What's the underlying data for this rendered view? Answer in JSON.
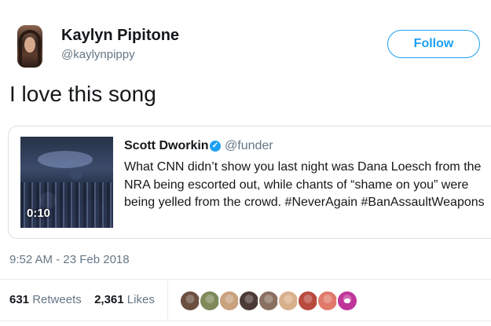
{
  "author": {
    "display_name": "Kaylyn Pipitone",
    "handle": "@kaylynpippy",
    "avatar_icon": "profile-photo"
  },
  "follow_button": {
    "label": "Follow",
    "color": "#1da1f2"
  },
  "tweet": {
    "text": "I love this song"
  },
  "quoted_tweet": {
    "author_name": "Scott Dworkin",
    "verified_icon": "verified-badge-icon",
    "handle": "@funder",
    "text": "What CNN didn’t show you last night was Dana Loesch from the NRA being escorted out, while chants of “shame on you” were being yelled from the crowd. #NeverAgain #BanAssaultWeapons",
    "video_duration": "0:10"
  },
  "timestamp": "9:52 AM - 23 Feb 2018",
  "stats": {
    "retweets_count": "631",
    "retweets_label": "Retweets",
    "likes_count": "2,361",
    "likes_label": "Likes"
  },
  "likers": [
    {
      "name": "liker-1",
      "color": "#6b4f3f"
    },
    {
      "name": "liker-2",
      "color": "#7e8a5a"
    },
    {
      "name": "liker-3",
      "color": "#c9a27e"
    },
    {
      "name": "liker-4",
      "color": "#4b3b36"
    },
    {
      "name": "liker-5",
      "color": "#8a7060"
    },
    {
      "name": "liker-6",
      "color": "#d9b08c"
    },
    {
      "name": "liker-7",
      "color": "#b84a3e"
    },
    {
      "name": "liker-8",
      "color": "#e07a6a"
    },
    {
      "name": "liker-9",
      "color": "#c0359a"
    }
  ]
}
